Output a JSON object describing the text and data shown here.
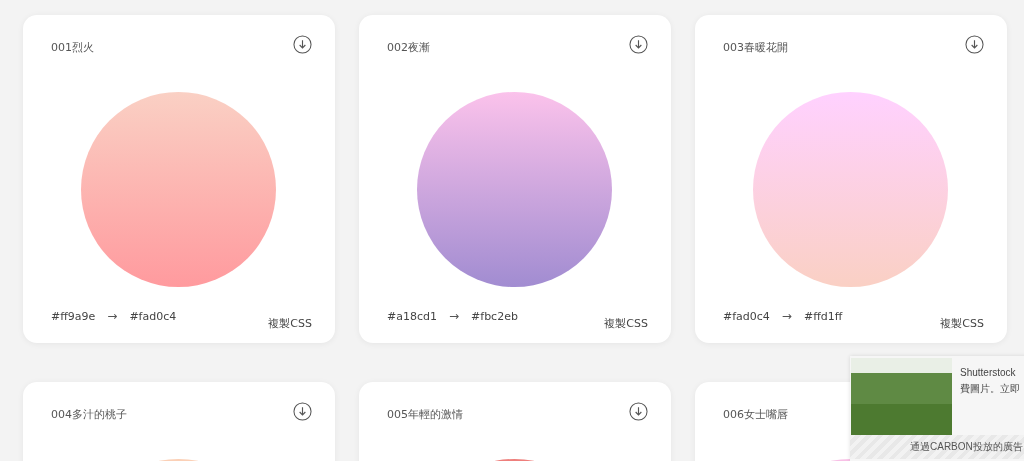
{
  "cards": [
    {
      "title": "001烈火",
      "codes": [
        "#ff9a9e",
        "→",
        "#fad0c4"
      ],
      "copy": "複製CSS"
    },
    {
      "title": "002夜漸",
      "codes": [
        "#a18cd1",
        "→",
        "#fbc2eb"
      ],
      "copy": "複製CSS"
    },
    {
      "title": "003春暖花開",
      "codes": [
        "#fad0c4",
        "→",
        "#ffd1ff"
      ],
      "copy": "複製CSS"
    },
    {
      "title": "004多汁的桃子",
      "color": "#fbd0b6"
    },
    {
      "title": "005年輕的激情",
      "color": "#ee7f7c"
    },
    {
      "title": "006女士嘴唇",
      "color": "#f8c0e6"
    }
  ],
  "ad": {
    "text": [
      "Shutterstock",
      "費圖片。立即"
    ],
    "footer": "通過CARBON投放的廣告"
  }
}
